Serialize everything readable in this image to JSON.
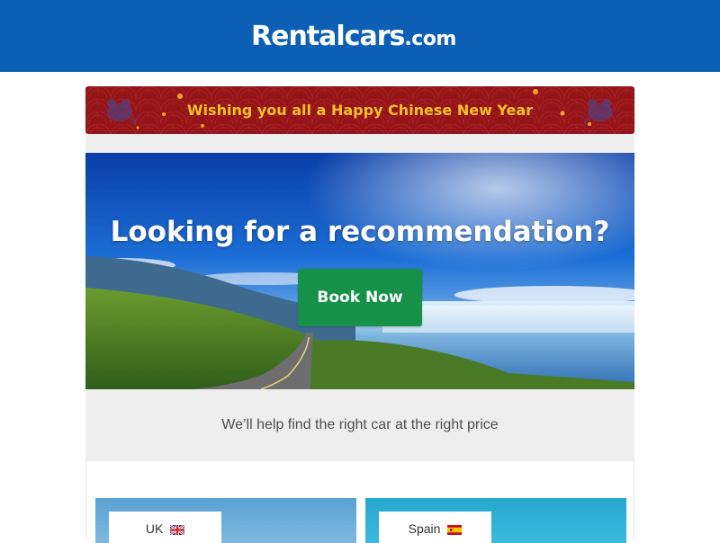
{
  "header": {
    "logo_main": "Rentalcars",
    "logo_suffix": ".com",
    "bg_color": "#0d5fb6"
  },
  "banner": {
    "text": "Wishing you all a Happy Chinese New Year",
    "bg_color": "#951418",
    "text_color": "#f6c229",
    "left_icon": "rat-icon",
    "right_icon": "rat-icon"
  },
  "hero": {
    "title": "Looking for a recommendation?",
    "button_label": "Book Now",
    "button_color": "#179149"
  },
  "tagline": "We’ll help find the right car at the right price",
  "destinations": [
    {
      "label": "UK",
      "flag": "uk-flag-icon"
    },
    {
      "label": "Spain",
      "flag": "spain-flag-icon"
    }
  ]
}
